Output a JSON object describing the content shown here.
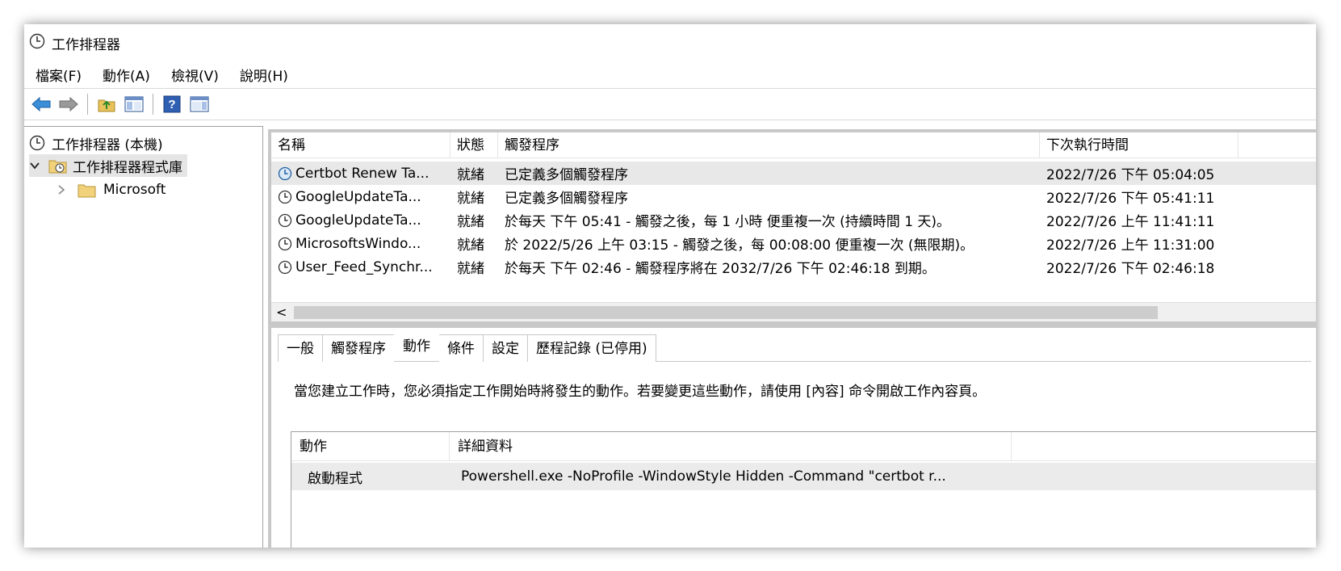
{
  "window": {
    "title": "工作排程器"
  },
  "menu": {
    "items": [
      "檔案(F)",
      "動作(A)",
      "檢視(V)",
      "說明(H)"
    ]
  },
  "toolbar": {
    "icons": [
      "back-arrow-icon",
      "forward-arrow-icon",
      "folder-up-icon",
      "show-hide-console-tree-icon",
      "help-icon",
      "show-hide-action-pane-icon"
    ]
  },
  "tree": {
    "root": "工作排程器 (本機)",
    "library": "工作排程器程式庫",
    "child": "Microsoft"
  },
  "tasks": {
    "columns": [
      "名稱",
      "狀態",
      "觸發程序",
      "下次執行時間"
    ],
    "rows": [
      {
        "name": "Certbot Renew Ta...",
        "status": "就緒",
        "trigger": "已定義多個觸發程序",
        "next": "2022/7/26 下午 05:04:05"
      },
      {
        "name": "GoogleUpdateTa...",
        "status": "就緒",
        "trigger": "已定義多個觸發程序",
        "next": "2022/7/26 下午 05:41:11"
      },
      {
        "name": "GoogleUpdateTa...",
        "status": "就緒",
        "trigger": "於每天 下午 05:41 - 觸發之後，每 1 小時 便重複一次 (持續時間 1 天)。",
        "next": "2022/7/26 上午 11:41:11"
      },
      {
        "name": "MicrosoftsWindo...",
        "status": "就緒",
        "trigger": "於 2022/5/26 上午 03:15 - 觸發之後，每 00:08:00 便重複一次 (無限期)。",
        "next": "2022/7/26 上午 11:31:00"
      },
      {
        "name": "User_Feed_Synchr...",
        "status": "就緒",
        "trigger": "於每天 下午 02:46 - 觸發程序將在 2032/7/26 下午 02:46:18 到期。",
        "next": "2022/7/26 下午 02:46:18"
      }
    ],
    "scroll_left_arrow": "<"
  },
  "detail_tabs": [
    "一般",
    "觸發程序",
    "動作",
    "條件",
    "設定",
    "歷程記錄 (已停用)"
  ],
  "active_tab": "動作",
  "actions": {
    "description": "當您建立工作時，您必須指定工作開始時將發生的動作。若要變更這些動作，請使用 [內容] 命令開啟工作內容頁。",
    "columns": [
      "動作",
      "詳細資料"
    ],
    "row": {
      "action": "啟動程式",
      "details": "Powershell.exe -NoProfile -WindowStyle Hidden -Command \"certbot r..."
    }
  }
}
